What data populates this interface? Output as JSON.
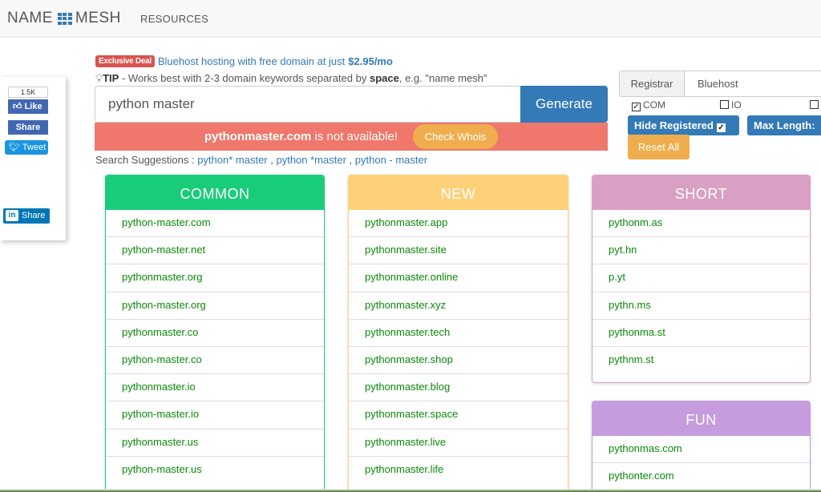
{
  "header": {
    "logo_left": "NAME",
    "logo_right": "MESH",
    "nav_resources": "RESOURCES"
  },
  "social": {
    "fb_count": "1.5K",
    "fb_like": "Like",
    "fb_share": "Share",
    "tweet": "Tweet",
    "li_in": "in",
    "li_share": "Share"
  },
  "deal": {
    "badge": "Exclusive Deal",
    "text": "Bluehost hosting with free domain at just",
    "price": "$2.95/mo"
  },
  "tip": {
    "label": "TIP",
    "text_before": " - Works best with 2-3 domain keywords separated by ",
    "keyword": "space",
    "text_after": ", e.g. \"name mesh\""
  },
  "search": {
    "value": "python master",
    "generate_label": "Generate"
  },
  "availability": {
    "domain": "pythonmaster.com",
    "message": " is not available!",
    "whois_label": "Check Whois"
  },
  "suggestions": {
    "label": "Search Suggestions : ",
    "items": [
      "python* master",
      "python *master",
      "python - master"
    ]
  },
  "filters": {
    "registrar_label": "Registrar",
    "registrar_value": "Bluehost",
    "tlds": [
      {
        "label": "COM",
        "checked": true
      },
      {
        "label": "IO",
        "checked": false
      },
      {
        "label": "",
        "checked": false
      }
    ],
    "hide_registered_label": "Hide Registered",
    "max_length_label": "Max Length:",
    "reset_label": "Reset All"
  },
  "panels": {
    "common": {
      "title": "COMMON",
      "color": "#19cc7a",
      "items": [
        "python-master.com",
        "python-master.net",
        "pythonmaster.org",
        "python-master.org",
        "pythonmaster.co",
        "python-master.co",
        "pythonmaster.io",
        "python-master.io",
        "pythonmaster.us",
        "python-master.us"
      ]
    },
    "new": {
      "title": "NEW",
      "color": "#fdd17a",
      "items": [
        "pythonmaster.app",
        "pythonmaster.site",
        "pythonmaster.online",
        "pythonmaster.xyz",
        "pythonmaster.tech",
        "pythonmaster.shop",
        "pythonmaster.blog",
        "pythonmaster.space",
        "pythonmaster.live",
        "pythonmaster.life"
      ]
    },
    "short": {
      "title": "SHORT",
      "color": "#d9a0c4",
      "items": [
        "pythonm.as",
        "pyt.hn",
        "p.yt",
        "pythn.ms",
        "pythonma.st",
        "pythnm.st"
      ]
    },
    "fun": {
      "title": "FUN",
      "color": "#c59cdd",
      "items": [
        "pythonmas.com",
        "pythonter.com"
      ]
    }
  }
}
